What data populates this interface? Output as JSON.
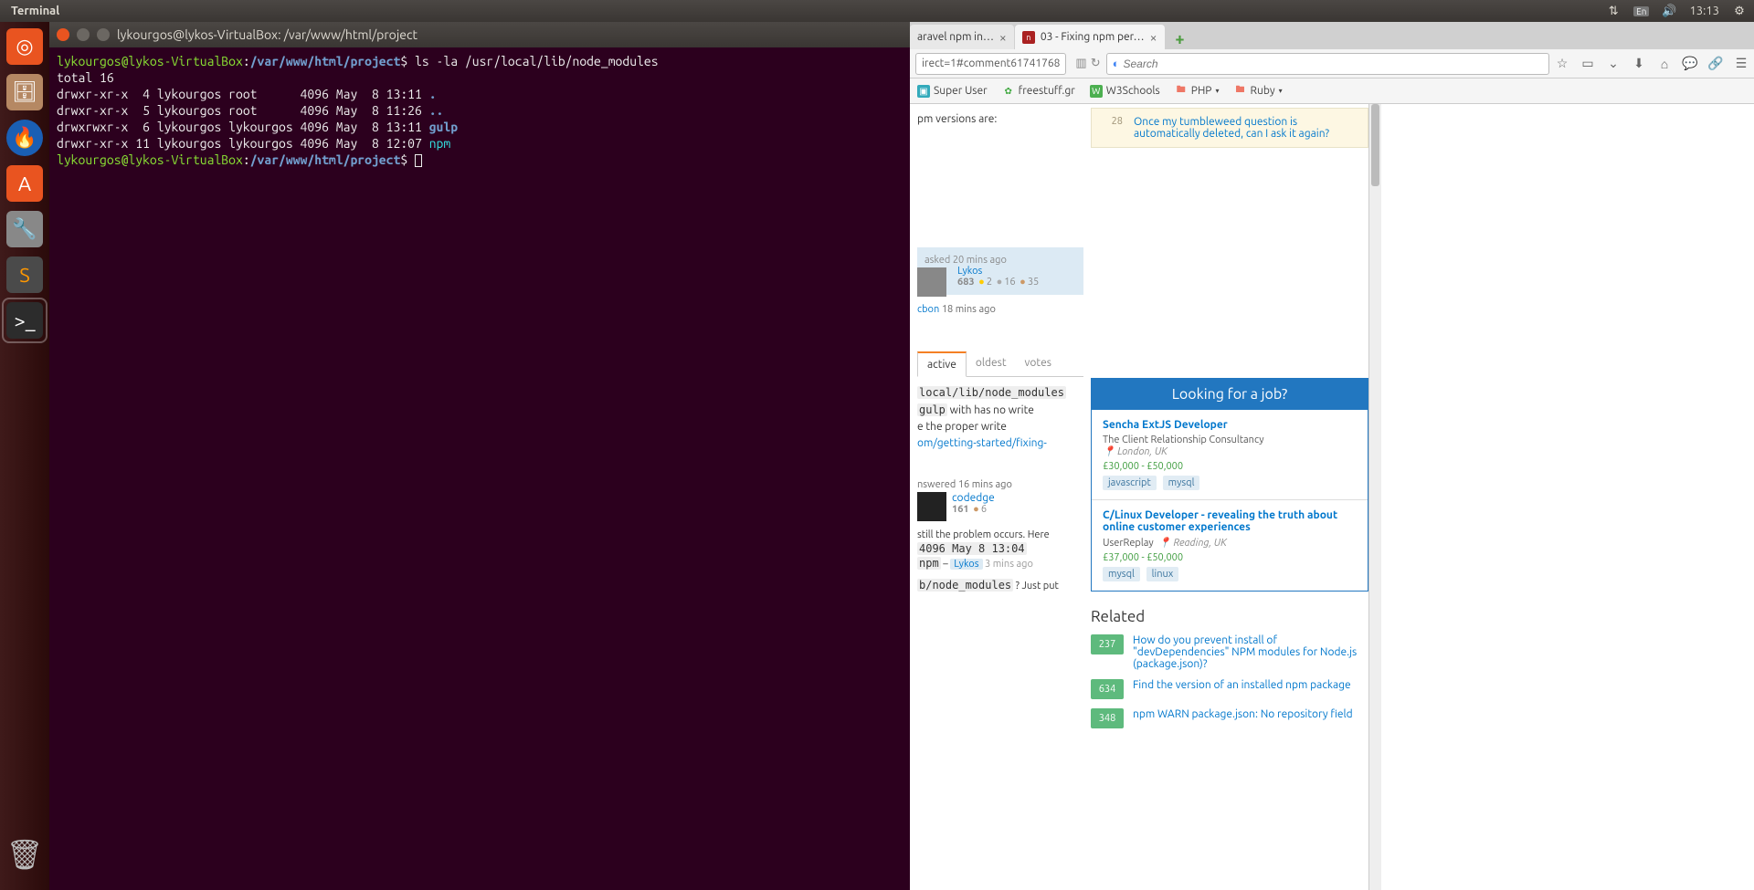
{
  "top_panel": {
    "title": "Terminal",
    "lang": "En",
    "time": "13:13"
  },
  "terminal": {
    "titlebar": "lykourgos@lykos-VirtualBox: /var/www/html/project",
    "prompt_user": "lykourgos@lykos-VirtualBox",
    "prompt_path": "/var/www/html/project",
    "cmd": "ls -la /usr/local/lib/node_modules",
    "lines": {
      "total": "total 16",
      "l1": "drwxr-xr-x  4 lykourgos root      4096 May  8 13:11 ",
      "l2": "drwxr-xr-x  5 lykourgos root      4096 May  8 11:26 ",
      "l3": "drwxrwxr-x  6 lykourgos lykourgos 4096 May  8 13:11 ",
      "l4": "drwxr-xr-x 11 lykourgos lykourgos 4096 May  8 12:07 ",
      "dot": ".",
      "dotdot": "..",
      "gulp": "gulp",
      "npm": "npm"
    }
  },
  "browser": {
    "tabs": [
      {
        "label": "aravel npm in…"
      },
      {
        "label": "03 - Fixing npm per…"
      }
    ],
    "url_fragment": "irect=1#comment61741768",
    "search_placeholder": "Search",
    "bookmarks": [
      {
        "label": "Super User"
      },
      {
        "label": "freestuff.gr"
      },
      {
        "label": "W3Schools"
      },
      {
        "label": "PHP",
        "dropdown": true
      },
      {
        "label": "Ruby",
        "dropdown": true
      }
    ],
    "bulletin": {
      "count": "28",
      "text": "Once my tumbleweed question is automatically deleted, can I ask it again?"
    },
    "main": {
      "frag1": "pm versions are:",
      "asked_ago": "asked 20 mins ago",
      "asker_name": "Lykos",
      "asker_rep": "683",
      "asker_gold": "2",
      "asker_silver": "16",
      "asker_bronze": "35",
      "edit_user": "cbon",
      "edit_ago": "18 mins ago",
      "tabs": {
        "active": "active",
        "oldest": "oldest",
        "votes": "votes"
      },
      "answer_frag1": "local/lib/node_modules",
      "answer_frag2": "gulp",
      "answer_frag3": " with has no write",
      "answer_frag4": "e the proper write",
      "answer_frag5": "om/getting-started/fixing-",
      "answered_ago": "nswered 16 mins ago",
      "answer_user": "codedge",
      "answer_rep": "161",
      "answer_bronze": "6",
      "comment1a": " still the problem occurs. Here",
      "comment1b": " 4096 May 8 13:04",
      "comment1c": "npm",
      "comment1d": " – ",
      "comment1e": "Lykos",
      "comment1f": "3 mins ago",
      "comment2a": "b/node_modules",
      "comment2b": " ? Just put"
    },
    "jobs": {
      "header": "Looking for a job?",
      "items": [
        {
          "title": "Sencha ExtJS Developer",
          "company": "The Client Relationship Consultancy",
          "location": "London, UK",
          "salary": "£30,000 - £50,000",
          "tags": [
            "javascript",
            "mysql"
          ]
        },
        {
          "title": "C/Linux Developer - revealing the truth about online customer experiences",
          "company": "UserReplay",
          "location": "Reading, UK",
          "salary": "£37,000 - £50,000",
          "tags": [
            "mysql",
            "linux"
          ]
        }
      ]
    },
    "related": {
      "header": "Related",
      "items": [
        {
          "count": "237",
          "text": "How do you prevent install of \"devDependencies\" NPM modules for Node.js (package.json)?"
        },
        {
          "count": "634",
          "text": "Find the version of an installed npm package"
        },
        {
          "count": "348",
          "text": "npm WARN package.json: No repository field"
        }
      ]
    }
  }
}
